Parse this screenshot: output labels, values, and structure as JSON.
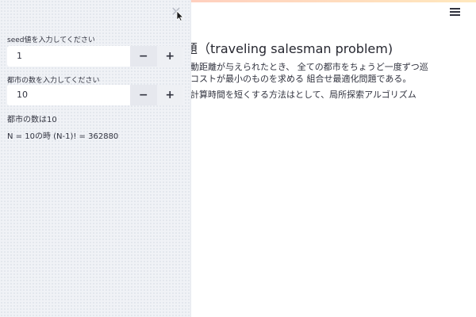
{
  "sidebar": {
    "close_icon": "close-icon",
    "seed_label": "seed値を入力してください",
    "seed_value": "1",
    "city_label": "都市の数を入力してください",
    "city_value": "10",
    "minus_label": "−",
    "plus_label": "+",
    "city_count_text": "都市の数は10",
    "permutation_text": "N = 10の時 (N-1)! = 362880"
  },
  "main": {
    "title": "題（traveling salesman problem)",
    "line1": "動距離が与えられたとき、 全ての都市をちょうど一度ずつ巡",
    "line2": "コストが最小のものを求める 組合せ最適化問題である。",
    "line3": "計算時間を短くする方法はとして、局所探索アルゴリズム",
    "menu_icon": "hamburger-menu-icon"
  }
}
